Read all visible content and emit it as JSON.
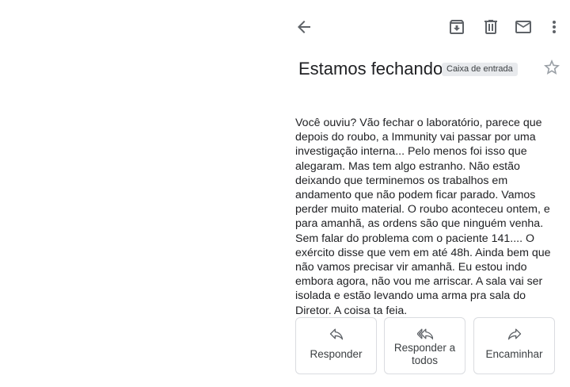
{
  "toolbar": {
    "back_icon": "arrow-back-icon",
    "archive_icon": "archive-icon",
    "delete_icon": "trash-icon",
    "mark_unread_icon": "mail-icon",
    "more_icon": "more-vert-icon"
  },
  "email": {
    "subject": "Estamos fechando",
    "label": "Caixa de entrada",
    "star_icon": "star-outline-icon",
    "body": "Você ouviu? Vão fechar o laboratório, parece que depois do roubo, a Immunity vai passar por uma investigação interna... Pelo menos foi isso que alegaram. Mas tem algo estranho. Não estão deixando que terminemos os trabalhos em andamento que não podem ficar parado. Vamos perder muito material. O roubo aconteceu ontem, e para amanhã, as ordens são que ninguém venha. Sem falar do problema com o paciente 141.... O exército disse que vem em até 48h. Ainda bem que não vamos precisar vir amanhã. Eu estou indo embora agora, não vou me arriscar. A sala vai ser isolada e estão levando uma arma pra sala do Diretor. A coisa ta feia."
  },
  "actions": {
    "reply": {
      "label": "Responder",
      "icon": "reply-icon"
    },
    "reply_all": {
      "label": "Responder a todos",
      "icon": "reply-all-icon"
    },
    "forward": {
      "label": "Encaminhar",
      "icon": "forward-icon"
    }
  },
  "colors": {
    "icon": "#5f6368",
    "text": "#202124",
    "chip_bg": "#e8eaed",
    "border": "#dadce0"
  }
}
